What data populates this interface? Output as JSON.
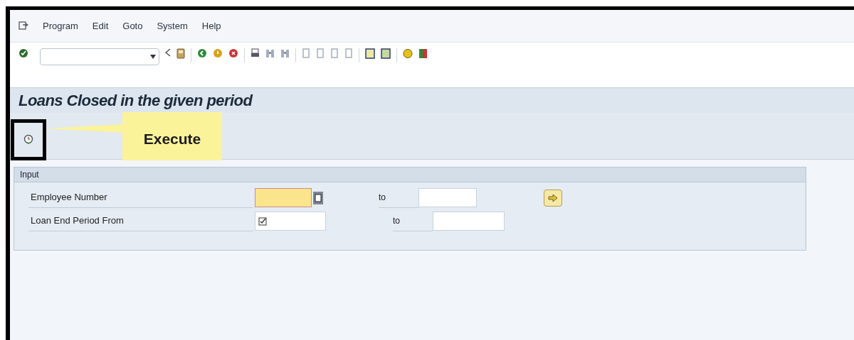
{
  "menu": [
    "Program",
    "Edit",
    "Goto",
    "System",
    "Help"
  ],
  "title": "Loans Closed in the given period",
  "callout": "Execute",
  "group": {
    "title": "Input",
    "rows": [
      {
        "label": "Employee Number",
        "highlighted": true,
        "required": false,
        "search_help": true,
        "multiple_selection": true,
        "to_label": "to"
      },
      {
        "label": "Loan End Period From",
        "highlighted": false,
        "required": true,
        "search_help": false,
        "multiple_selection": false,
        "to_label": "to"
      }
    ]
  }
}
